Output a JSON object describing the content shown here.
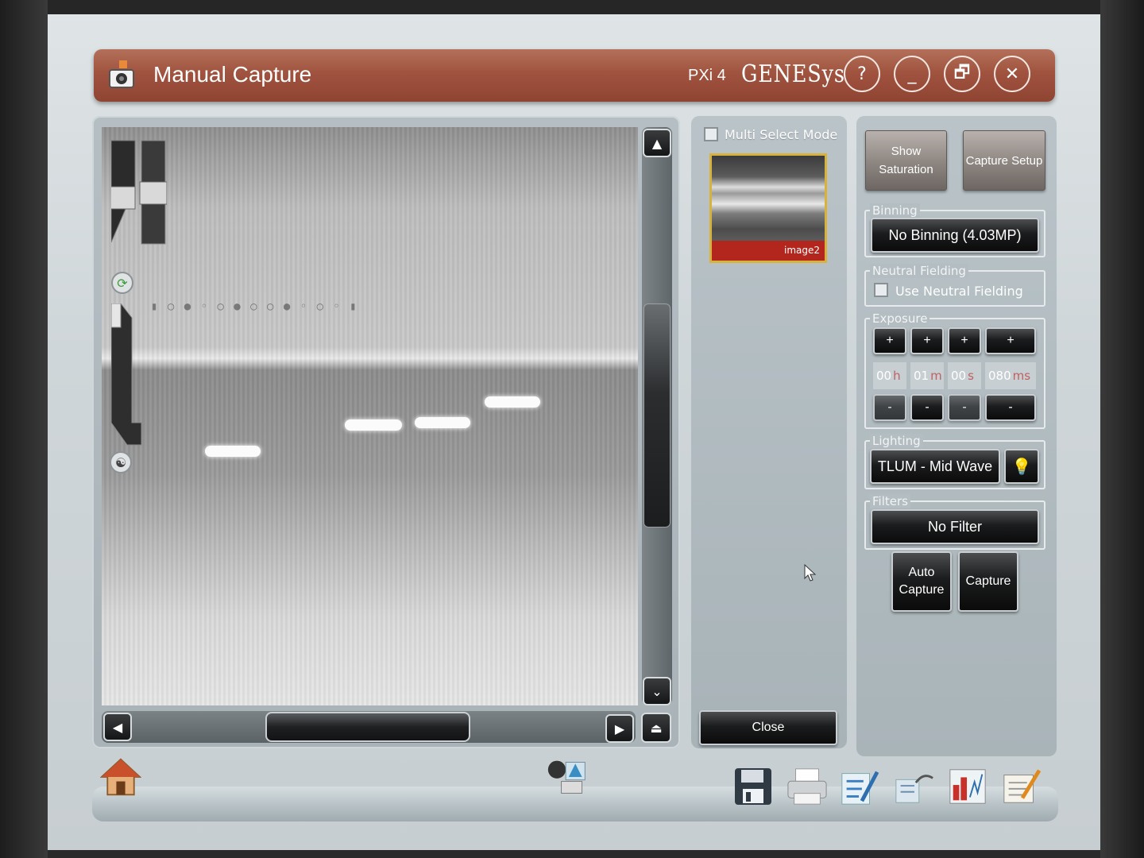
{
  "window": {
    "title": "Manual Capture",
    "model": "PXi 4",
    "brand": "GENESys",
    "help_label": "?",
    "minimize_label": "_",
    "restore_label": "🗗",
    "close_label": "✕"
  },
  "thumbnails": {
    "multi_select_label": "Multi Select Mode",
    "multi_select_checked": false,
    "items": [
      {
        "caption": "image2"
      }
    ],
    "close_label": "Close"
  },
  "settings": {
    "show_saturation_label": "Show Saturation",
    "capture_setup_label": "Capture Setup",
    "binning": {
      "label": "Binning",
      "value": "No Binning (4.03MP)"
    },
    "neutral_fielding": {
      "label": "Neutral Fielding",
      "checkbox_label": "Use Neutral Fielding",
      "checked": false
    },
    "exposure": {
      "label": "Exposure",
      "plus_label": "+",
      "minus_label": "-",
      "hours": "00",
      "hours_unit": "h",
      "minutes": "01",
      "minutes_unit": "m",
      "seconds": "00",
      "seconds_unit": "s",
      "ms": "080",
      "ms_unit": "ms"
    },
    "lighting": {
      "label": "Lighting",
      "value": "TLUM - Mid Wave",
      "icon": "bulb-icon"
    },
    "filters": {
      "label": "Filters",
      "value": "No Filter"
    },
    "auto_capture_label": "Auto Capture",
    "capture_label": "Capture"
  },
  "toolbar": {
    "icons": [
      "home-icon",
      "transfer-icon",
      "save-icon",
      "print-icon",
      "annotate-icon",
      "network-icon",
      "analysis-icon",
      "notes-icon"
    ]
  },
  "colors": {
    "titlebar": "#a0533f",
    "selected_thumb_border": "#d8b23a",
    "thumb_caption_bg": "#b3261e"
  }
}
